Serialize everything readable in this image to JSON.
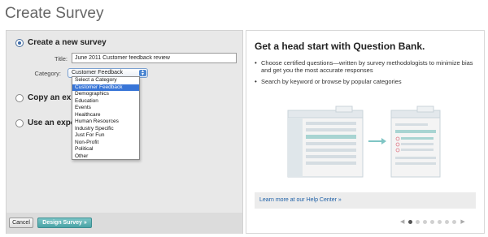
{
  "page": {
    "title": "Create Survey"
  },
  "left": {
    "options": [
      {
        "label": "Create a new survey",
        "checked": true
      },
      {
        "label": "Copy an exis",
        "checked": false
      },
      {
        "label": "Use an expe",
        "checked": false
      }
    ],
    "title_field": {
      "label": "Title:",
      "value": "June 2011 Customer feedback review"
    },
    "category_field": {
      "label": "Category:",
      "selected": "Customer Feedback"
    },
    "dropdown_options": [
      "Select a Category",
      "Customer Feedback",
      "Demographics",
      "Education",
      "Events",
      "Healthcare",
      "Human Resources",
      "Industry Specific",
      "Just For Fun",
      "Non-Profit",
      "Political",
      "Other"
    ],
    "dropdown_selected_index": 1,
    "buttons": {
      "cancel": "Cancel",
      "design": "Design Survey »"
    }
  },
  "right": {
    "title": "Get a head start with Question Bank.",
    "bullets": [
      "Choose certified questions—written by survey methodologists to minimize bias and get you the most accurate responses",
      "Search by keyword or browse by popular categories"
    ],
    "help_link": "Learn more at our Help Center »",
    "carousel": {
      "total": 7,
      "active": 0
    }
  },
  "colors": {
    "accent_blue": "#3875d7",
    "design_button": "#4aa3a6",
    "link": "#1d5fa6"
  },
  "icons": {
    "prev": "chevron-left-icon",
    "next": "chevron-right-icon"
  }
}
